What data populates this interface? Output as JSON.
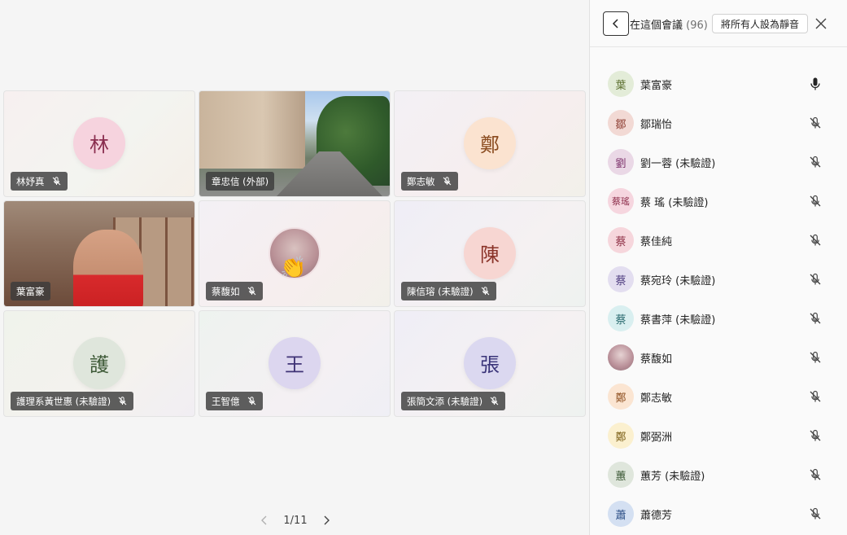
{
  "tiles": [
    {
      "name": "林妤真",
      "initial": "林",
      "avatar_bg": "#f6d3de",
      "avatar_fg": "#8a2e4f",
      "muted": true
    },
    {
      "name": "章忠信 (外部)",
      "type": "campus-video"
    },
    {
      "name": "鄭志敏",
      "initial": "鄭",
      "avatar_bg": "#fbe3d0",
      "avatar_fg": "#8a4b1f",
      "muted": true
    },
    {
      "name": "葉富豪",
      "type": "office-video"
    },
    {
      "name": "蔡馥如",
      "type": "photo-avatar",
      "reaction": "👏",
      "muted": true
    },
    {
      "name": "陳信瑢 (未驗證)",
      "initial": "陳",
      "avatar_bg": "#f7d6d2",
      "avatar_fg": "#8a3328",
      "muted": true
    },
    {
      "name": "護理系黃世惠 (未驗證)",
      "initial": "護",
      "avatar_bg": "#dfe6dc",
      "avatar_fg": "#3e5a37",
      "muted": true
    },
    {
      "name": "王智億",
      "initial": "王",
      "avatar_bg": "#dcd6ef",
      "avatar_fg": "#3f3376",
      "muted": true
    },
    {
      "name": "張簡文添 (未驗證)",
      "initial": "張",
      "avatar_bg": "#dbd8f0",
      "avatar_fg": "#3a3479",
      "muted": true
    }
  ],
  "pager": {
    "label": "1/11"
  },
  "panel": {
    "title": "在這個會議",
    "count": "(96)",
    "mute_all_label": "將所有人設為靜音",
    "participants": [
      {
        "initial": "葉",
        "name": "葉富豪",
        "avatar_bg": "#e3ecd8",
        "avatar_fg": "#5a6e2d",
        "muted": false
      },
      {
        "initial": "鄒",
        "name": "鄒瑞怡",
        "avatar_bg": "#f2d9d4",
        "avatar_fg": "#8b3a2e",
        "muted": true
      },
      {
        "initial": "劉",
        "name": "劉一蓉 (未驗證)",
        "avatar_bg": "#ead8e6",
        "avatar_fg": "#7b2f6a",
        "muted": true
      },
      {
        "initial": "蔡瑤",
        "name": "蔡 瑤 (未驗證)",
        "avatar_bg": "#f6d6df",
        "avatar_fg": "#8e2f4c",
        "muted": true
      },
      {
        "initial": "蔡",
        "name": "蔡佳純",
        "avatar_bg": "#f6d6dc",
        "avatar_fg": "#8e2f45",
        "muted": true
      },
      {
        "initial": "蔡",
        "name": "蔡宛玲 (未驗證)",
        "avatar_bg": "#e3def0",
        "avatar_fg": "#4f3d80",
        "muted": true
      },
      {
        "initial": "蔡",
        "name": "蔡書萍 (未驗證)",
        "avatar_bg": "#d9eff0",
        "avatar_fg": "#2a6a6f",
        "muted": true
      },
      {
        "initial": "",
        "name": "蔡馥如",
        "avatar_bg": "#c9a7ad",
        "avatar_fg": "#ffffff",
        "muted": true,
        "photo": true
      },
      {
        "initial": "鄭",
        "name": "鄭志敏",
        "avatar_bg": "#fbe5d2",
        "avatar_fg": "#8d4e1f",
        "muted": true
      },
      {
        "initial": "鄭",
        "name": "鄭弼洲",
        "avatar_bg": "#fbf0cf",
        "avatar_fg": "#7a5d14",
        "muted": true
      },
      {
        "initial": "蕙",
        "name": "蕙芳 (未驗證)",
        "avatar_bg": "#dfe6dc",
        "avatar_fg": "#3e5a37",
        "muted": true
      },
      {
        "initial": "蕭",
        "name": "蕭德芳",
        "avatar_bg": "#d4e0f2",
        "avatar_fg": "#2c4f86",
        "muted": true
      }
    ]
  }
}
